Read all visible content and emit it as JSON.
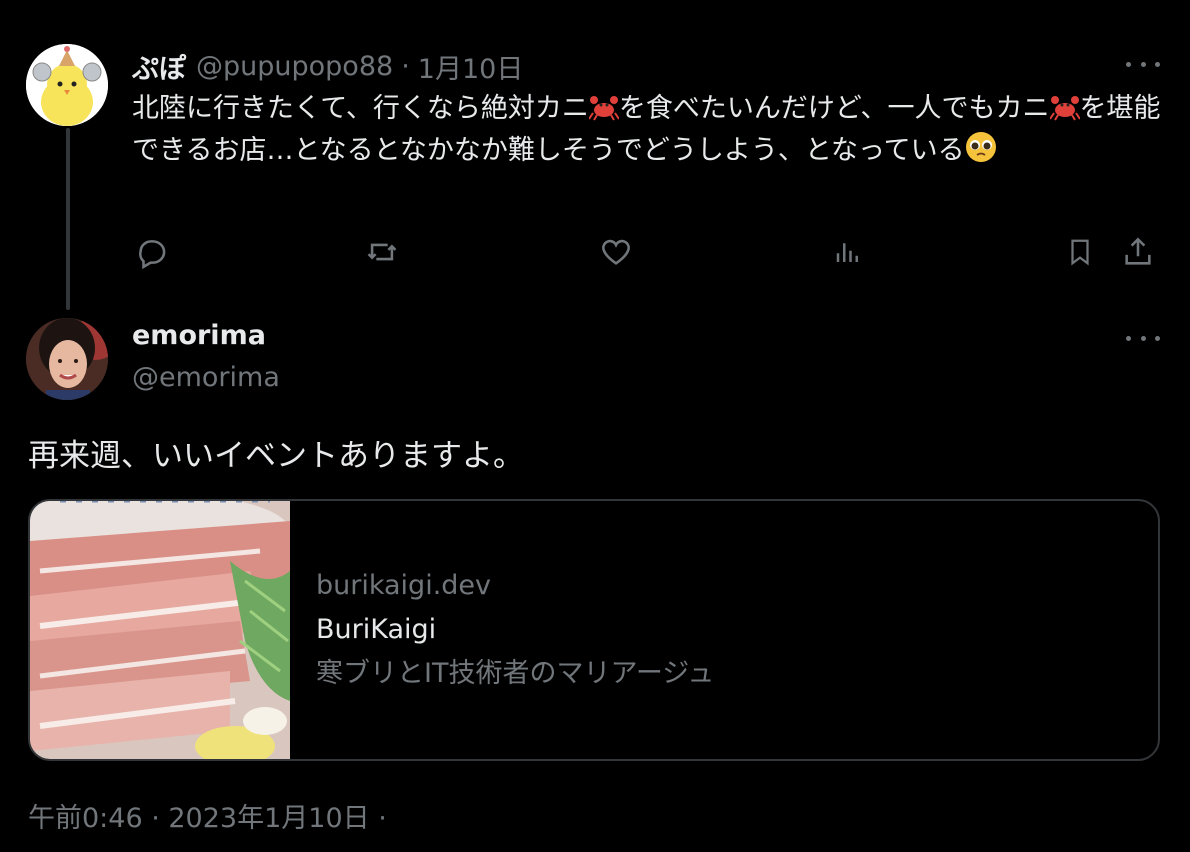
{
  "tweet1": {
    "display_name": "ぷぽ",
    "handle": "@pupupopo88",
    "separator": "·",
    "date": "1月10日",
    "text_part1": "北陸に行きたくて、行くなら絶対カニ",
    "text_part2": "を食べたいんだけど、一人でもカニ",
    "text_part3": "を堪能できるお店…となるとなかなか難しそうでどうしよう、となっている",
    "emoji_crab": "crab-emoji",
    "emoji_pleading": "pleading-face-emoji",
    "actions": [
      "reply-icon",
      "retweet-icon",
      "like-icon",
      "views-icon",
      "bookmark-icon",
      "share-icon"
    ]
  },
  "tweet2": {
    "display_name": "emorima",
    "handle": "@emorima",
    "text": "再来週、いいイベントありますよ。",
    "card": {
      "domain": "burikaigi.dev",
      "title": "BuriKaigi",
      "description": "寒ブリとIT技術者のマリアージュ"
    },
    "timestamp": "午前0:46 · 2023年1月10日 ·"
  },
  "colors": {
    "background": "#000000",
    "text": "#e7e9ea",
    "muted": "#71767b",
    "border": "#333639"
  }
}
